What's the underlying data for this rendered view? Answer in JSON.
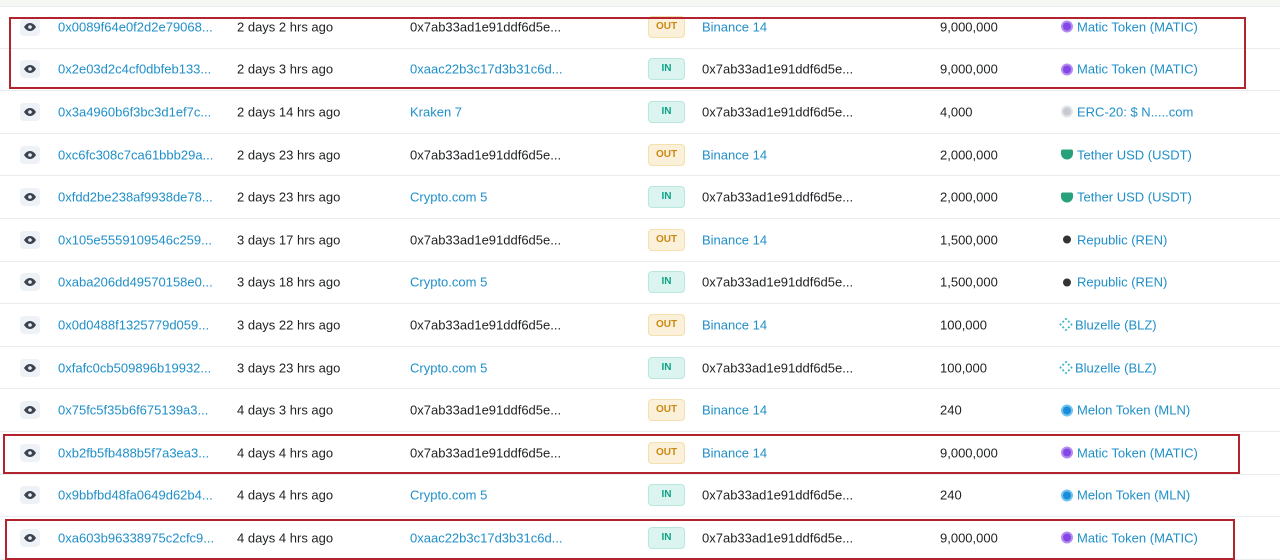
{
  "colors": {
    "link": "#1f8fc9",
    "out_badge_bg": "#fbf0d9",
    "out_badge_text": "#c98a14",
    "in_badge_bg": "#dcf4ef",
    "in_badge_text": "#0fa287",
    "highlight_box": "#b3232e"
  },
  "rows": [
    {
      "hash": "0x0089f64e0f2d2e79068...",
      "age": "2 days 2 hrs ago",
      "from": "0x7ab33ad1e91ddf6d5e...",
      "from_is_link": false,
      "direction": "OUT",
      "to": "Binance 14",
      "to_is_link": true,
      "quantity": "9,000,000",
      "token": "Matic Token (MATIC)",
      "token_icon": "matic-icon"
    },
    {
      "hash": "0x2e03d2c4cf0dbfeb133...",
      "age": "2 days 3 hrs ago",
      "from": "0xaac22b3c17d3b31c6d...",
      "from_is_link": true,
      "direction": "IN",
      "to": "0x7ab33ad1e91ddf6d5e...",
      "to_is_link": false,
      "quantity": "9,000,000",
      "token": "Matic Token (MATIC)",
      "token_icon": "matic-icon"
    },
    {
      "hash": "0x3a4960b6f3bc3d1ef7c...",
      "age": "2 days 14 hrs ago",
      "from": "Kraken 7",
      "from_is_link": true,
      "direction": "IN",
      "to": "0x7ab33ad1e91ddf6d5e...",
      "to_is_link": false,
      "quantity": "4,000",
      "token": "ERC-20: $ N.....com",
      "token_icon": "erc20-icon"
    },
    {
      "hash": "0xc6fc308c7ca61bbb29a...",
      "age": "2 days 23 hrs ago",
      "from": "0x7ab33ad1e91ddf6d5e...",
      "from_is_link": false,
      "direction": "OUT",
      "to": "Binance 14",
      "to_is_link": true,
      "quantity": "2,000,000",
      "token": "Tether USD (USDT)",
      "token_icon": "tether-icon"
    },
    {
      "hash": "0xfdd2be238af9938de78...",
      "age": "2 days 23 hrs ago",
      "from": "Crypto.com 5",
      "from_is_link": true,
      "direction": "IN",
      "to": "0x7ab33ad1e91ddf6d5e...",
      "to_is_link": false,
      "quantity": "2,000,000",
      "token": "Tether USD (USDT)",
      "token_icon": "tether-icon"
    },
    {
      "hash": "0x105e5559109546c259...",
      "age": "3 days 17 hrs ago",
      "from": "0x7ab33ad1e91ddf6d5e...",
      "from_is_link": false,
      "direction": "OUT",
      "to": "Binance 14",
      "to_is_link": true,
      "quantity": "1,500,000",
      "token": "Republic (REN)",
      "token_icon": "ren-icon"
    },
    {
      "hash": "0xaba206dd49570158e0...",
      "age": "3 days 18 hrs ago",
      "from": "Crypto.com 5",
      "from_is_link": true,
      "direction": "IN",
      "to": "0x7ab33ad1e91ddf6d5e...",
      "to_is_link": false,
      "quantity": "1,500,000",
      "token": "Republic (REN)",
      "token_icon": "ren-icon"
    },
    {
      "hash": "0x0d0488f1325779d059...",
      "age": "3 days 22 hrs ago",
      "from": "0x7ab33ad1e91ddf6d5e...",
      "from_is_link": false,
      "direction": "OUT",
      "to": "Binance 14",
      "to_is_link": true,
      "quantity": "100,000",
      "token": "Bluzelle (BLZ)",
      "token_icon": "blz-icon"
    },
    {
      "hash": "0xfafc0cb509896b19932...",
      "age": "3 days 23 hrs ago",
      "from": "Crypto.com 5",
      "from_is_link": true,
      "direction": "IN",
      "to": "0x7ab33ad1e91ddf6d5e...",
      "to_is_link": false,
      "quantity": "100,000",
      "token": "Bluzelle (BLZ)",
      "token_icon": "blz-icon"
    },
    {
      "hash": "0x75fc5f35b6f675139a3...",
      "age": "4 days 3 hrs ago",
      "from": "0x7ab33ad1e91ddf6d5e...",
      "from_is_link": false,
      "direction": "OUT",
      "to": "Binance 14",
      "to_is_link": true,
      "quantity": "240",
      "token": "Melon Token (MLN)",
      "token_icon": "mln-icon"
    },
    {
      "hash": "0xb2fb5fb488b5f7a3ea3...",
      "age": "4 days 4 hrs ago",
      "from": "0x7ab33ad1e91ddf6d5e...",
      "from_is_link": false,
      "direction": "OUT",
      "to": "Binance 14",
      "to_is_link": true,
      "quantity": "9,000,000",
      "token": "Matic Token (MATIC)",
      "token_icon": "matic-icon"
    },
    {
      "hash": "0x9bbfbd48fa0649d62b4...",
      "age": "4 days 4 hrs ago",
      "from": "Crypto.com 5",
      "from_is_link": true,
      "direction": "IN",
      "to": "0x7ab33ad1e91ddf6d5e...",
      "to_is_link": false,
      "quantity": "240",
      "token": "Melon Token (MLN)",
      "token_icon": "mln-icon"
    },
    {
      "hash": "0xa603b96338975c2cfc9...",
      "age": "4 days 4 hrs ago",
      "from": "0xaac22b3c17d3b31c6d...",
      "from_is_link": true,
      "direction": "IN",
      "to": "0x7ab33ad1e91ddf6d5e...",
      "to_is_link": false,
      "quantity": "9,000,000",
      "token": "Matic Token (MATIC)",
      "token_icon": "matic-icon"
    }
  ]
}
